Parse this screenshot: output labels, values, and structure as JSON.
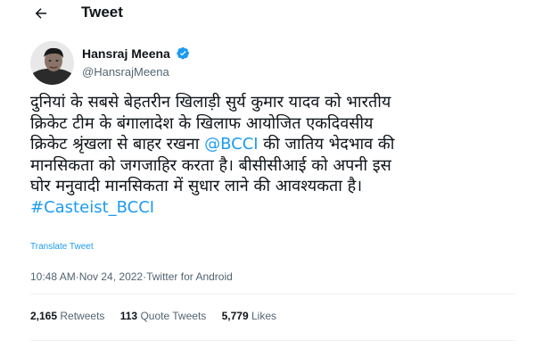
{
  "header": {
    "title": "Tweet",
    "back_icon": "arrow-left-icon"
  },
  "author": {
    "name": "Hansraj Meena",
    "handle": "@HansrajMeena",
    "verified_icon": "verified-badge-icon",
    "verified_color": "#1d9bf0"
  },
  "tweet": {
    "line1": "दुनियां के सबसे बेहतरीन खिलाड़ी सुर्य कुमार यादव को भारतीय",
    "line2": "क्रिकेट टीम के बंगालादेश के खिलाफ आयोजित एकदिवसीय",
    "line3_pre": "क्रिकेट श्रृंखला से बाहर रखना ",
    "mention": "@BCCI",
    "line3_post": " की जातिय भेदभाव की",
    "line4": "मानसिकता को जगजाहिर करता है। बीसीसीआई को अपनी इस",
    "line5": "घोर मनुवादी मानसिकता में सुधार लाने की आवश्यकता है।",
    "hashtag": "#Casteist_BCCI",
    "link_color": "#1d9bf0"
  },
  "translate_label": "Translate Tweet",
  "meta": {
    "time": "10:48 AM",
    "separator": " · ",
    "date": "Nov 24, 2022",
    "source": "Twitter for Android"
  },
  "stats": {
    "retweets_count": "2,165",
    "retweets_label": "Retweets",
    "quotes_count": "113",
    "quotes_label": "Quote Tweets",
    "likes_count": "5,779",
    "likes_label": "Likes"
  }
}
